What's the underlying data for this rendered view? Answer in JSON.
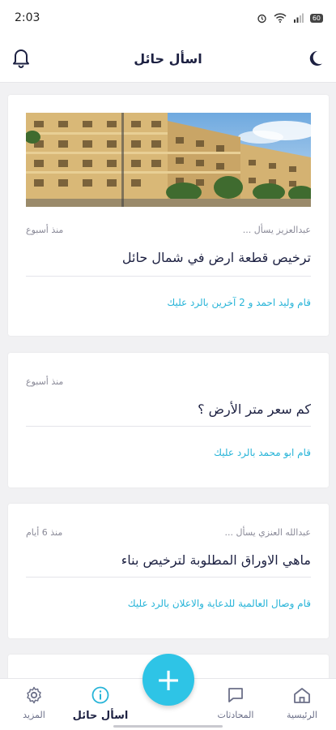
{
  "status_bar": {
    "time": "2:03",
    "battery": "60"
  },
  "app_bar": {
    "title": "اسأل حائل",
    "left_icon": "bell-icon",
    "right_icon": "moon-icon"
  },
  "posts": [
    {
      "has_image": true,
      "author": "عبدالعزيز يسأل ...",
      "time": "منذ أسبوع",
      "question": "ترخيص قطعة ارض في شمال حائل",
      "replies": "قام وليد احمد و 2 آخرين بالرد عليك"
    },
    {
      "has_image": false,
      "author": "",
      "time": "منذ أسبوع",
      "question": "كم سعر متر الأرض ؟",
      "replies": "قام ابو محمد بالرد عليك"
    },
    {
      "has_image": false,
      "author": "عبدالله العنزي يسأل ...",
      "time": "منذ 6 أيام",
      "question": "ماهي الاوراق المطلوبة لترخيص بناء",
      "replies": "قام وصال العالمية للدعاية والاعلان بالرد عليك"
    }
  ],
  "bottom_nav": {
    "home": "الرئيسية",
    "chats": "المحادثات",
    "ask": "اسأل حائل",
    "more": "المزيد"
  },
  "fab": {
    "symbol": "+"
  },
  "colors": {
    "accent": "#2ec4e6",
    "link": "#27b4d8",
    "title": "#1d2142"
  }
}
